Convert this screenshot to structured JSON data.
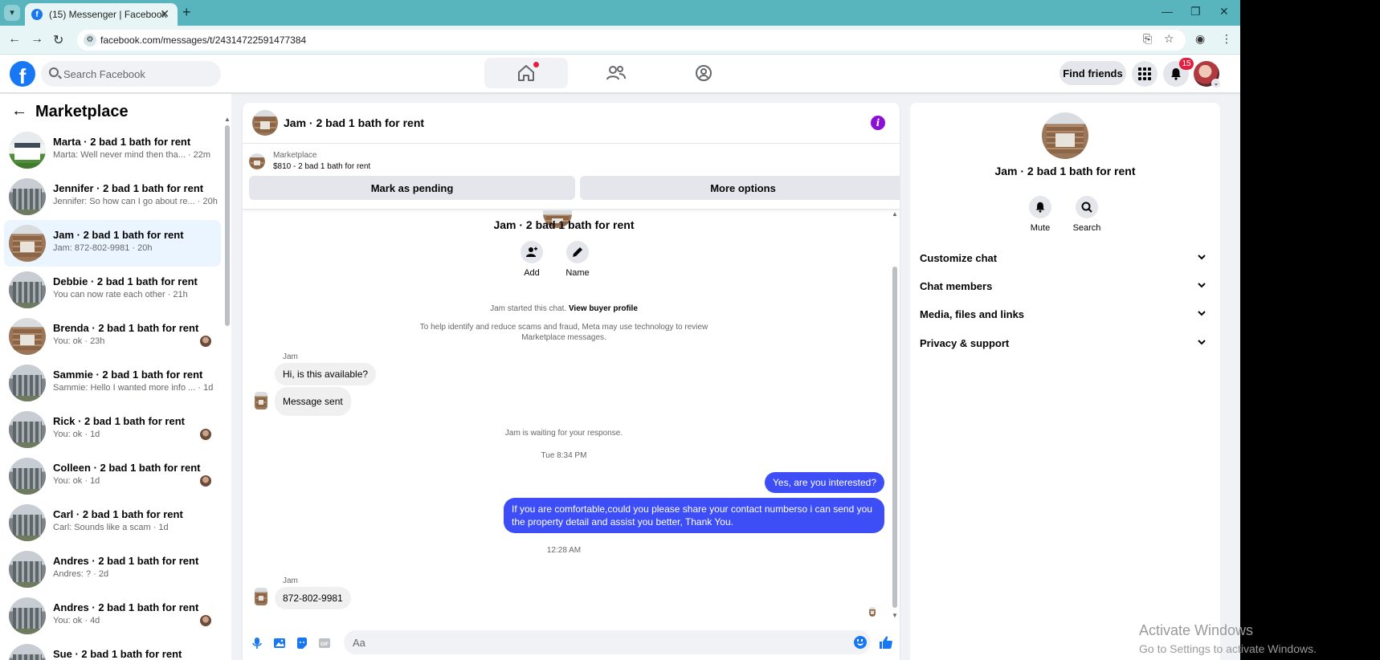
{
  "browser": {
    "tab_title": "(15) Messenger | Facebook",
    "url": "facebook.com/messages/t/24314722591477384"
  },
  "header": {
    "search_placeholder": "Search Facebook",
    "find_friends": "Find friends",
    "notification_count": "15"
  },
  "sidebar": {
    "title": "Marketplace",
    "conversations": [
      {
        "name": "Marta · 2 bad 1 bath for rent",
        "snippet": "Marta: Well never mind then tha... · 22m",
        "thumb": "green",
        "mini": false
      },
      {
        "name": "Jennifer · 2 bad 1 bath for rent",
        "snippet": "Jennifer: So how can I go about re... · 20h",
        "thumb": "gray",
        "mini": false
      },
      {
        "name": "Jam · 2 bad 1 bath for rent",
        "snippet": "Jam: 872-802-9981 · 20h",
        "thumb": "brick",
        "mini": false,
        "active": true
      },
      {
        "name": "Debbie · 2 bad 1 bath for rent",
        "snippet": "You can now rate each other · 21h",
        "thumb": "gray",
        "mini": false
      },
      {
        "name": "Brenda · 2 bad 1 bath for rent",
        "snippet": "You: ok · 23h",
        "thumb": "brick",
        "mini": true
      },
      {
        "name": "Sammie · 2 bad 1 bath for rent",
        "snippet": "Sammie: Hello I wanted more info ...  · 1d",
        "thumb": "gray",
        "mini": false
      },
      {
        "name": "Rick · 2 bad 1 bath for rent",
        "snippet": "You: ok · 1d",
        "thumb": "gray",
        "mini": true
      },
      {
        "name": "Colleen · 2 bad 1 bath for rent",
        "snippet": "You: ok · 1d",
        "thumb": "gray",
        "mini": true
      },
      {
        "name": "Carl · 2 bad 1 bath for rent",
        "snippet": "Carl: Sounds like a scam · 1d",
        "thumb": "gray",
        "mini": false
      },
      {
        "name": "Andres · 2 bad 1 bath for rent",
        "snippet": "Andres: ? · 2d",
        "thumb": "gray",
        "mini": false
      },
      {
        "name": "Andres · 2 bad 1 bath for rent",
        "snippet": "You: ok · 4d",
        "thumb": "gray",
        "mini": true
      },
      {
        "name": "Sue · 2 bad 1 bath for rent",
        "snippet": "",
        "thumb": "gray",
        "mini": true
      }
    ]
  },
  "chat": {
    "title": "Jam · 2 bad 1 bath for rent",
    "marketplace_label": "Marketplace",
    "listing": "$810 - 2 bad 1 bath for rent",
    "mark_pending": "Mark as pending",
    "more_options": "More options",
    "conversation_name": "Jam · 2 bad 1 bath for rent",
    "add_label": "Add",
    "name_label": "Name",
    "started_text": "Jam started this chat.",
    "view_buyer": "View buyer profile",
    "scam_notice_line1": "To help identify and reduce scams and fraud, Meta may use technology to review",
    "scam_notice_line2": "Marketplace messages.",
    "sender": "Jam",
    "msg_available": "Hi, is this available?",
    "msg_sent": "Message sent",
    "waiting": "Jam is waiting for your response.",
    "time1": "Tue 8:34 PM",
    "out1": "Yes, are you interested?",
    "out2_line1": "If you are comfortable,could you please share your contact numberso i can send you",
    "out2_line2": "the property detail and assist you better, Thank You.",
    "time2": "12:28 AM",
    "msg_phone": "872-802-9981",
    "composer_placeholder": "Aa"
  },
  "details": {
    "name": "Jam · 2 bad 1 bath for rent",
    "mute": "Mute",
    "search": "Search",
    "sections": [
      "Customize chat",
      "Chat members",
      "Media, files and links",
      "Privacy & support"
    ]
  },
  "watermark": {
    "line1": "Activate Windows",
    "line2": "Go to Settings to activate Windows."
  },
  "colors": {
    "fb_blue": "#1877f2",
    "outgoing_bubble": "#3e4ef6",
    "tabbar": "#58b5bd",
    "active_conversation": "#ebf5ff"
  }
}
